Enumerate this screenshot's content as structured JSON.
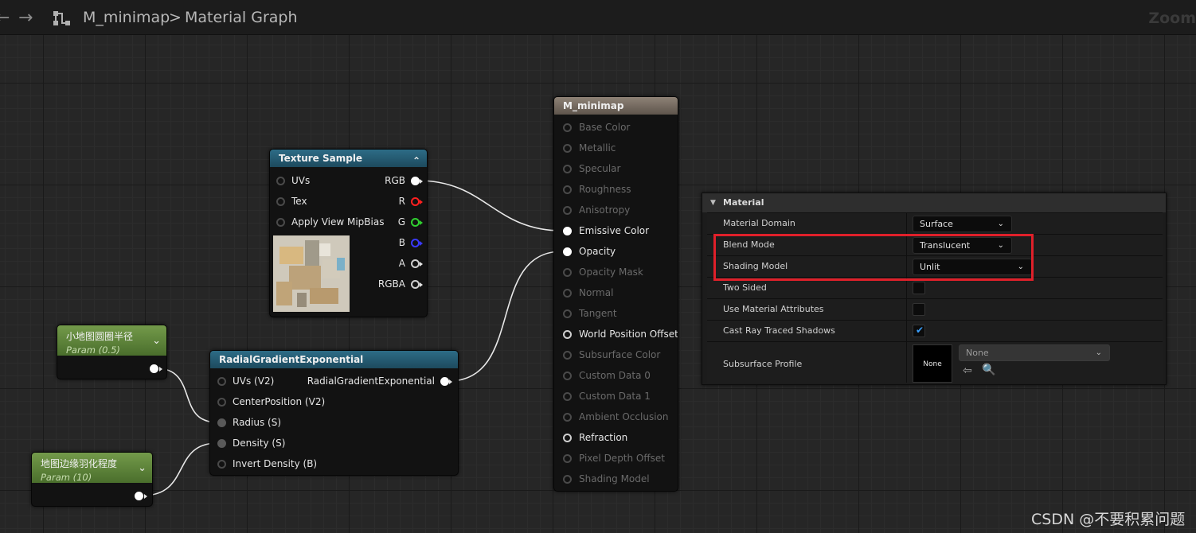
{
  "topbar": {
    "breadcrumb_root": "M_minimap",
    "breadcrumb_separator": ">",
    "breadcrumb_current": "Material Graph",
    "zoom_label": "Zoom"
  },
  "nodes": {
    "texture_sample": {
      "title": "Texture Sample",
      "inputs": [
        "UVs",
        "Tex",
        "Apply View MipBias"
      ],
      "outputs": [
        "RGB",
        "R",
        "G",
        "B",
        "A",
        "RGBA"
      ]
    },
    "param_radius": {
      "title": "小地图圆圈半径",
      "subtitle": "Param (0.5)"
    },
    "param_density": {
      "title": "地图边缘羽化程度",
      "subtitle": "Param (10)"
    },
    "radial_gradient": {
      "title": "RadialGradientExponential",
      "inputs": [
        "UVs (V2)",
        "CenterPosition (V2)",
        "Radius (S)",
        "Density (S)",
        "Invert Density (B)"
      ],
      "output": "RadialGradientExponential"
    },
    "material_result": {
      "title": "M_minimap",
      "pins": [
        "Base Color",
        "Metallic",
        "Specular",
        "Roughness",
        "Anisotropy",
        "Emissive Color",
        "Opacity",
        "Opacity Mask",
        "Normal",
        "Tangent",
        "World Position Offset",
        "Subsurface Color",
        "Custom Data 0",
        "Custom Data 1",
        "Ambient Occlusion",
        "Refraction",
        "Pixel Depth Offset",
        "Shading Model"
      ]
    }
  },
  "details": {
    "section_title": "Material",
    "material_domain": {
      "label": "Material Domain",
      "value": "Surface"
    },
    "blend_mode": {
      "label": "Blend Mode",
      "value": "Translucent"
    },
    "shading_model": {
      "label": "Shading Model",
      "value": "Unlit"
    },
    "two_sided": {
      "label": "Two Sided",
      "checked": false
    },
    "use_material_attributes": {
      "label": "Use Material Attributes",
      "checked": false
    },
    "cast_ray_traced_shadows": {
      "label": "Cast Ray Traced Shadows",
      "checked": true
    },
    "subsurface_profile": {
      "label": "Subsurface Profile",
      "thumbnail": "None",
      "value": "None"
    }
  },
  "watermark": "CSDN @不要积累问题",
  "icons": {
    "back": "arrow-left-icon",
    "forward": "arrow-right-icon",
    "graph": "graph-icon",
    "expand": "chevron-icon",
    "browse": "browse-icon",
    "use_selected": "use-selected-icon"
  },
  "colors": {
    "highlight": "#e0202a",
    "blue_header": "#2d6c86",
    "green_header": "#739a4a",
    "brown_header": "#8e8276",
    "pin_red": "#ff2020",
    "pin_green": "#30d030",
    "pin_blue": "#3a3aff"
  }
}
